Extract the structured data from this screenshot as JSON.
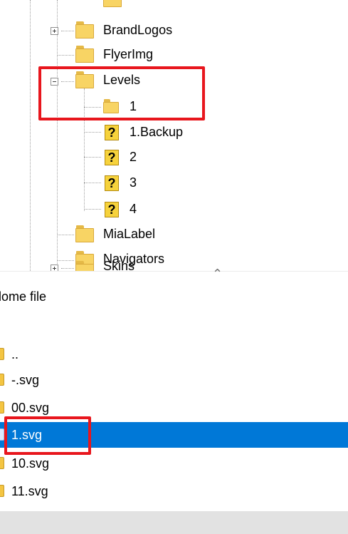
{
  "tree": {
    "items": [
      {
        "label": ""
      },
      {
        "label": "BrandLogos"
      },
      {
        "label": "FlyerImg"
      },
      {
        "label": "Levels"
      },
      {
        "label": "1"
      },
      {
        "label": "1.Backup"
      },
      {
        "label": "2"
      },
      {
        "label": "3"
      },
      {
        "label": "4"
      },
      {
        "label": "MiaLabel"
      },
      {
        "label": "Navigators"
      },
      {
        "label": "Skins"
      }
    ]
  },
  "file_list": {
    "header": "lome file",
    "rows": [
      {
        "name": ".."
      },
      {
        "name": "-.svg"
      },
      {
        "name": "00.svg"
      },
      {
        "name": "1.svg",
        "selected": true
      },
      {
        "name": "10.svg"
      },
      {
        "name": "11.svg"
      }
    ]
  },
  "colors": {
    "selection": "#0078d7",
    "highlight_box": "#e8161d",
    "folder": "#f8d464"
  },
  "icons": {
    "folder": "folder-icon",
    "unknown": "question-mark-icon",
    "expand": "plus-box-icon",
    "collapse": "minus-box-icon"
  }
}
